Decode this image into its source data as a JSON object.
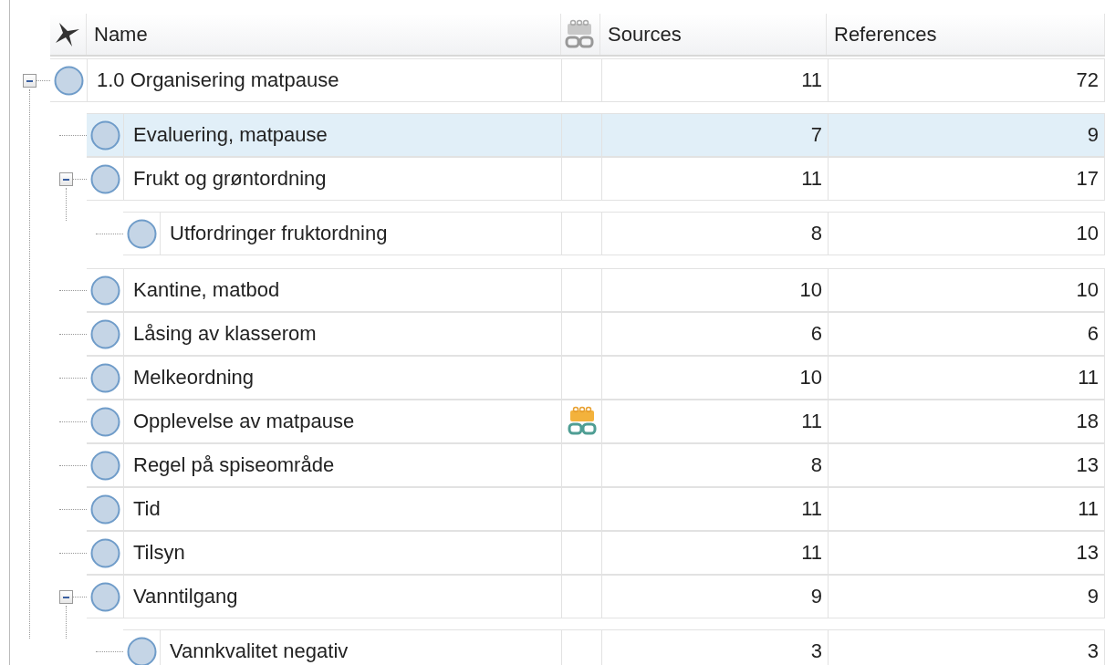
{
  "columns": [
    {
      "label": "Name",
      "kind": "name"
    },
    {
      "label": "Sources",
      "kind": "sources"
    },
    {
      "label": "References",
      "kind": "references"
    }
  ],
  "rows": [
    {
      "name": "1.0 Organisering matpause",
      "sources": "11",
      "references": "72",
      "selected": false,
      "linked": false,
      "expanded": true,
      "children": [
        {
          "name": "Evaluering, matpause",
          "sources": "7",
          "references": "9",
          "selected": true,
          "linked": false
        },
        {
          "name": "Frukt og grøntordning",
          "sources": "11",
          "references": "17",
          "selected": false,
          "linked": false,
          "expanded": true,
          "children": [
            {
              "name": "Utfordringer fruktordning",
              "sources": "8",
              "references": "10",
              "selected": false,
              "linked": false
            }
          ]
        },
        {
          "name": "Kantine, matbod",
          "sources": "10",
          "references": "10",
          "selected": false,
          "linked": false
        },
        {
          "name": "Låsing av klasserom",
          "sources": "6",
          "references": "6",
          "selected": false,
          "linked": false
        },
        {
          "name": "Melkeordning",
          "sources": "10",
          "references": "11",
          "selected": false,
          "linked": false
        },
        {
          "name": "Opplevelse av matpause",
          "sources": "11",
          "references": "18",
          "selected": false,
          "linked": true
        },
        {
          "name": "Regel på spiseområde",
          "sources": "8",
          "references": "13",
          "selected": false,
          "linked": false
        },
        {
          "name": "Tid",
          "sources": "11",
          "references": "11",
          "selected": false,
          "linked": false
        },
        {
          "name": "Tilsyn",
          "sources": "11",
          "references": "13",
          "selected": false,
          "linked": false
        },
        {
          "name": "Vanntilgang",
          "sources": "9",
          "references": "9",
          "selected": false,
          "linked": false,
          "expanded": true,
          "children": [
            {
              "name": "Vannkvalitet negativ",
              "sources": "3",
              "references": "3",
              "selected": false,
              "linked": false
            }
          ]
        }
      ]
    }
  ]
}
